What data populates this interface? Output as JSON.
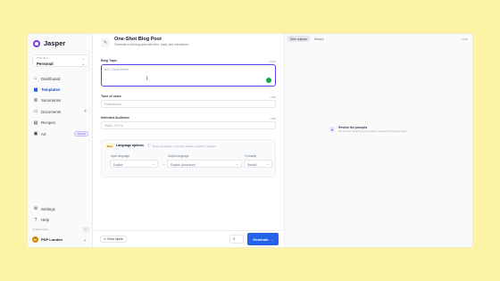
{
  "sidebar": {
    "brand": "Jasper",
    "project": {
      "label": "PROJECT",
      "value": "Personal"
    },
    "nav": [
      {
        "label": "Dashboard",
        "icon": "home-icon"
      },
      {
        "label": "Templates",
        "icon": "grid-icon",
        "active": true
      },
      {
        "label": "Summaries",
        "icon": "list-icon"
      },
      {
        "label": "Documents",
        "icon": "document-icon"
      },
      {
        "label": "Recipes",
        "icon": "book-icon"
      },
      {
        "label": "Art",
        "icon": "image-icon",
        "badge": "CREATE"
      }
    ],
    "settings": "Settings",
    "help": "Help",
    "upgrade": "Upgrade plan",
    "upgrade_kbd": "⌘K",
    "user": {
      "initials": "PL",
      "name": "PDP London"
    }
  },
  "main": {
    "template_title": "One-Shot Blog Post",
    "template_desc": "Generate a full blog post with intro, body, and conclusion.",
    "blog_topic": {
      "label": "Blog Topic",
      "count": "0/400",
      "placeholder": "B2C Social Media"
    },
    "tone": {
      "label": "Tone of voice",
      "count": "0/80",
      "placeholder": "Professional"
    },
    "audience": {
      "label": "Intended Audience",
      "count": "0/80",
      "placeholder": "SMEs, CEO's"
    },
    "language": {
      "beta": "Beta",
      "title": "Language options",
      "note": "Deepl integration is currently disabled. Enable in Settings.",
      "input_label": "Input language",
      "input_value": "English",
      "output_label": "Output language",
      "output_value": "English (American)",
      "formality_label": "Formality",
      "formality_value": "Default"
    },
    "footer": {
      "clear": "✕ Clear inputs",
      "qty": "3",
      "generate": "Generate →"
    }
  },
  "right": {
    "tabs": [
      {
        "label": "New outputs",
        "active": true
      },
      {
        "label": "History"
      }
    ],
    "clear": "Clear",
    "review_title": "Review the prompts",
    "review_sub": "Get the best results by trying multiple inputs and of varying lengths."
  },
  "colors": {
    "accent": "#2563eb",
    "brand": "#7c3aed",
    "background": "#fdf3a6"
  }
}
